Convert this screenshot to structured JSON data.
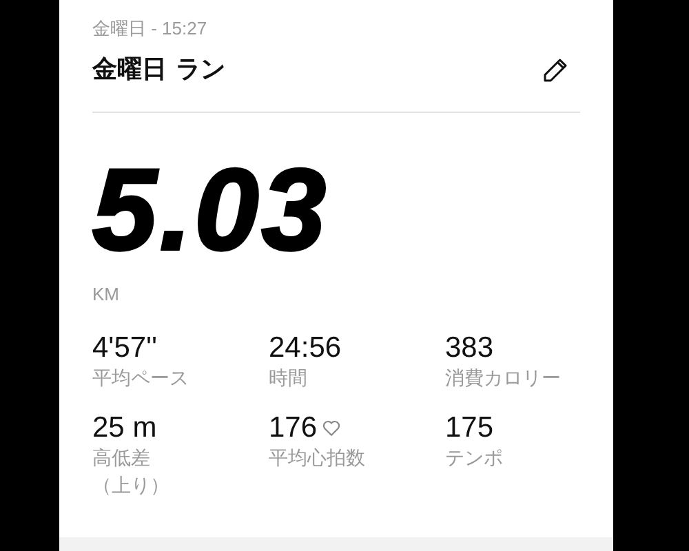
{
  "header": {
    "date": "金曜日 - 15:27",
    "title": "金曜日 ラン"
  },
  "distance": {
    "value": "5.03",
    "unit": "KM"
  },
  "stats": [
    {
      "kind": "plain",
      "value": "4'57''",
      "label": "平均ペース"
    },
    {
      "kind": "plain",
      "value": "24:56",
      "label": "時間"
    },
    {
      "kind": "plain",
      "value": "383",
      "label": "消費カロリー"
    },
    {
      "kind": "plain",
      "value": "25 m",
      "label": "高低差（上り）"
    },
    {
      "kind": "heart",
      "value": "176",
      "label": "平均心拍数"
    },
    {
      "kind": "plain",
      "value": "175",
      "label": "テンポ"
    }
  ]
}
